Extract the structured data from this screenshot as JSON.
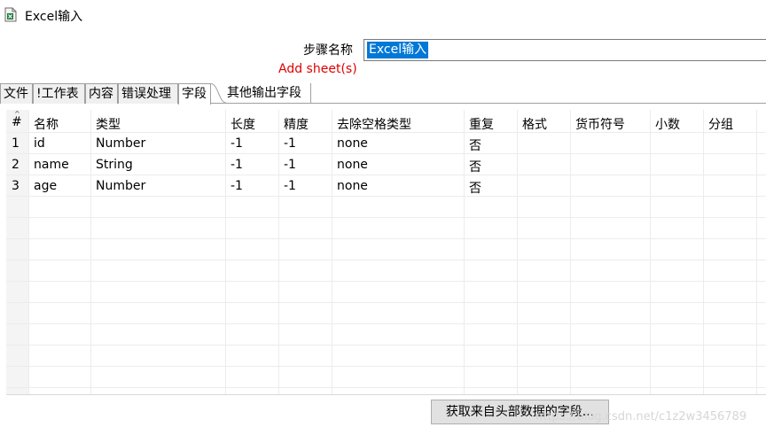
{
  "window": {
    "title": "Excel输入"
  },
  "step": {
    "label": "步骤名称",
    "name_value": "Excel输入"
  },
  "add_sheet_warning": "Add sheet(s)",
  "tabs": [
    {
      "label": "文件"
    },
    {
      "label": "!工作表"
    },
    {
      "label": "内容"
    },
    {
      "label": "错误处理"
    },
    {
      "label": "字段",
      "active": true
    },
    {
      "label": "其他输出字段"
    }
  ],
  "table": {
    "columns": [
      "#",
      "名称",
      "类型",
      "长度",
      "精度",
      "去除空格类型",
      "重复",
      "格式",
      "货币符号",
      "小数",
      "分组"
    ],
    "rows": [
      {
        "num": "1",
        "name": "id",
        "type": "Number",
        "length": "-1",
        "precision": "-1",
        "trim": "none",
        "repeat": "否"
      },
      {
        "num": "2",
        "name": "name",
        "type": "String",
        "length": "-1",
        "precision": "-1",
        "trim": "none",
        "repeat": "否"
      },
      {
        "num": "3",
        "name": "age",
        "type": "Number",
        "length": "-1",
        "precision": "-1",
        "trim": "none",
        "repeat": "否"
      }
    ]
  },
  "buttons": {
    "get_fields": "获取来自头部数据的字段..."
  },
  "watermark": "https://blog.csdn.net/c1z2w3456789",
  "colors": {
    "selection": "#0078d7",
    "warning": "#e00000"
  }
}
